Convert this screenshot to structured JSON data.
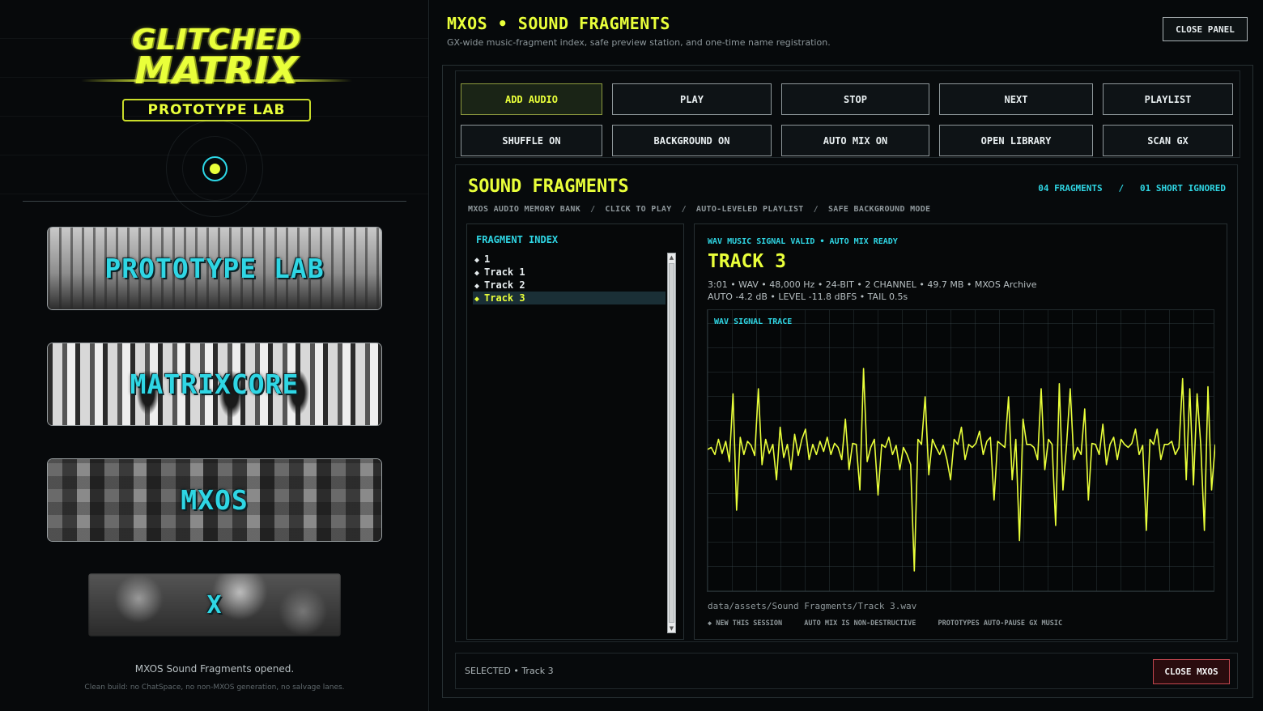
{
  "sidebar": {
    "logo": {
      "line1": "GLITCHED",
      "line2": "MATRIX",
      "subtitle": "PROTOTYPE LAB"
    },
    "cards": [
      {
        "label": "PROTOTYPE LAB"
      },
      {
        "label": "MATRIXCORE"
      },
      {
        "label": "MXOS"
      },
      {
        "label": "X"
      }
    ],
    "status": "MXOS Sound Fragments opened.",
    "note": "Clean build: no ChatSpace, no non-MXOS generation, no salvage lanes."
  },
  "header": {
    "title": "MXOS • SOUND FRAGMENTS",
    "subtitle": "GX-wide music-fragment index, safe preview station, and one-time name registration.",
    "close_label": "CLOSE PANEL"
  },
  "toolbar": {
    "row1": [
      "ADD AUDIO",
      "PLAY",
      "STOP",
      "NEXT",
      "PLAYLIST"
    ],
    "row2": [
      "SHUFFLE ON",
      "BACKGROUND ON",
      "AUTO MIX ON",
      "OPEN LIBRARY",
      "SCAN GX"
    ]
  },
  "fragments": {
    "title": "SOUND FRAGMENTS",
    "counts": "04 FRAGMENTS   /   01 SHORT IGNORED",
    "crumbs": [
      "MXOS AUDIO MEMORY BANK",
      "CLICK TO PLAY",
      "AUTO-LEVELED PLAYLIST",
      "SAFE BACKGROUND MODE"
    ],
    "index_title": "FRAGMENT INDEX",
    "items": [
      "1",
      "Track 1",
      "Track 2",
      "Track 3"
    ],
    "selected_index": 3
  },
  "detail": {
    "status": "WAV MUSIC SIGNAL VALID • AUTO MIX READY",
    "title": "TRACK 3",
    "meta_line1": "3:01 • WAV • 48,000 Hz • 24-BIT • 2 CHANNEL • 49.7 MB • MXOS Archive",
    "meta_line2": "AUTO -4.2 dB • LEVEL -11.8 dBFS • TAIL 0.5s",
    "trace_label": "WAV SIGNAL TRACE",
    "path": "data/assets/Sound Fragments/Track 3.wav",
    "notes": [
      "◆ NEW THIS SESSION",
      "AUTO MIX IS NON-DESTRUCTIVE",
      "PROTOTYPES AUTO-PAUSE GX MUSIC"
    ],
    "signal": [
      0,
      0.02,
      -0.05,
      0.1,
      -0.04,
      0.08,
      -0.12,
      0.55,
      -0.6,
      0.12,
      -0.05,
      0.08,
      0.04,
      -0.06,
      0.6,
      -0.15,
      0.1,
      -0.04,
      0.05,
      -0.3,
      0.22,
      -0.08,
      0.05,
      -0.2,
      0.15,
      -0.06,
      0.1,
      0.2,
      -0.1,
      0.05,
      -0.05,
      0.08,
      -0.02,
      0.12,
      -0.05,
      0.06,
      0.02,
      -0.1,
      0.3,
      -0.2,
      0.06,
      0.05,
      -0.4,
      0.8,
      -0.12,
      0.02,
      0.1,
      -0.45,
      0.05,
      0.02,
      0.12,
      -0.05,
      0.04,
      -0.2,
      0.02,
      -0.05,
      -0.15,
      -1.2,
      0.1,
      0.05,
      0.52,
      -0.25,
      0.1,
      0.02,
      -0.05,
      0.04,
      -0.1,
      -0.3,
      0.1,
      0.05,
      0.22,
      -0.1,
      0.05,
      0.02,
      0.06,
      0.18,
      -0.05,
      0.08,
      0.12,
      -0.5,
      0.08,
      0.05,
      0.02,
      0.52,
      -0.3,
      0.1,
      -0.9,
      0.3,
      0.05,
      0.05,
      0.02,
      -0.1,
      0.6,
      -0.2,
      0.1,
      0.05,
      -0.75,
      0.65,
      -0.4,
      0.05,
      0.6,
      -0.1,
      0.02,
      -0.05,
      0.4,
      -0.5,
      0.06,
      0.05,
      -0.05,
      0.25,
      -0.15,
      0.05,
      0.12,
      -0.1,
      0.1,
      0.05,
      0.02,
      0.06,
      0.2,
      -0.05,
      0.04,
      -0.8,
      0.1,
      0.05,
      0.2,
      -0.1,
      0.05,
      0.05,
      0.08,
      -0.05,
      0.02,
      0.7,
      -0.3,
      0.6,
      -0.35,
      0.55,
      0.05,
      -0.8,
      0.62,
      -0.4,
      0.05
    ]
  }
}
